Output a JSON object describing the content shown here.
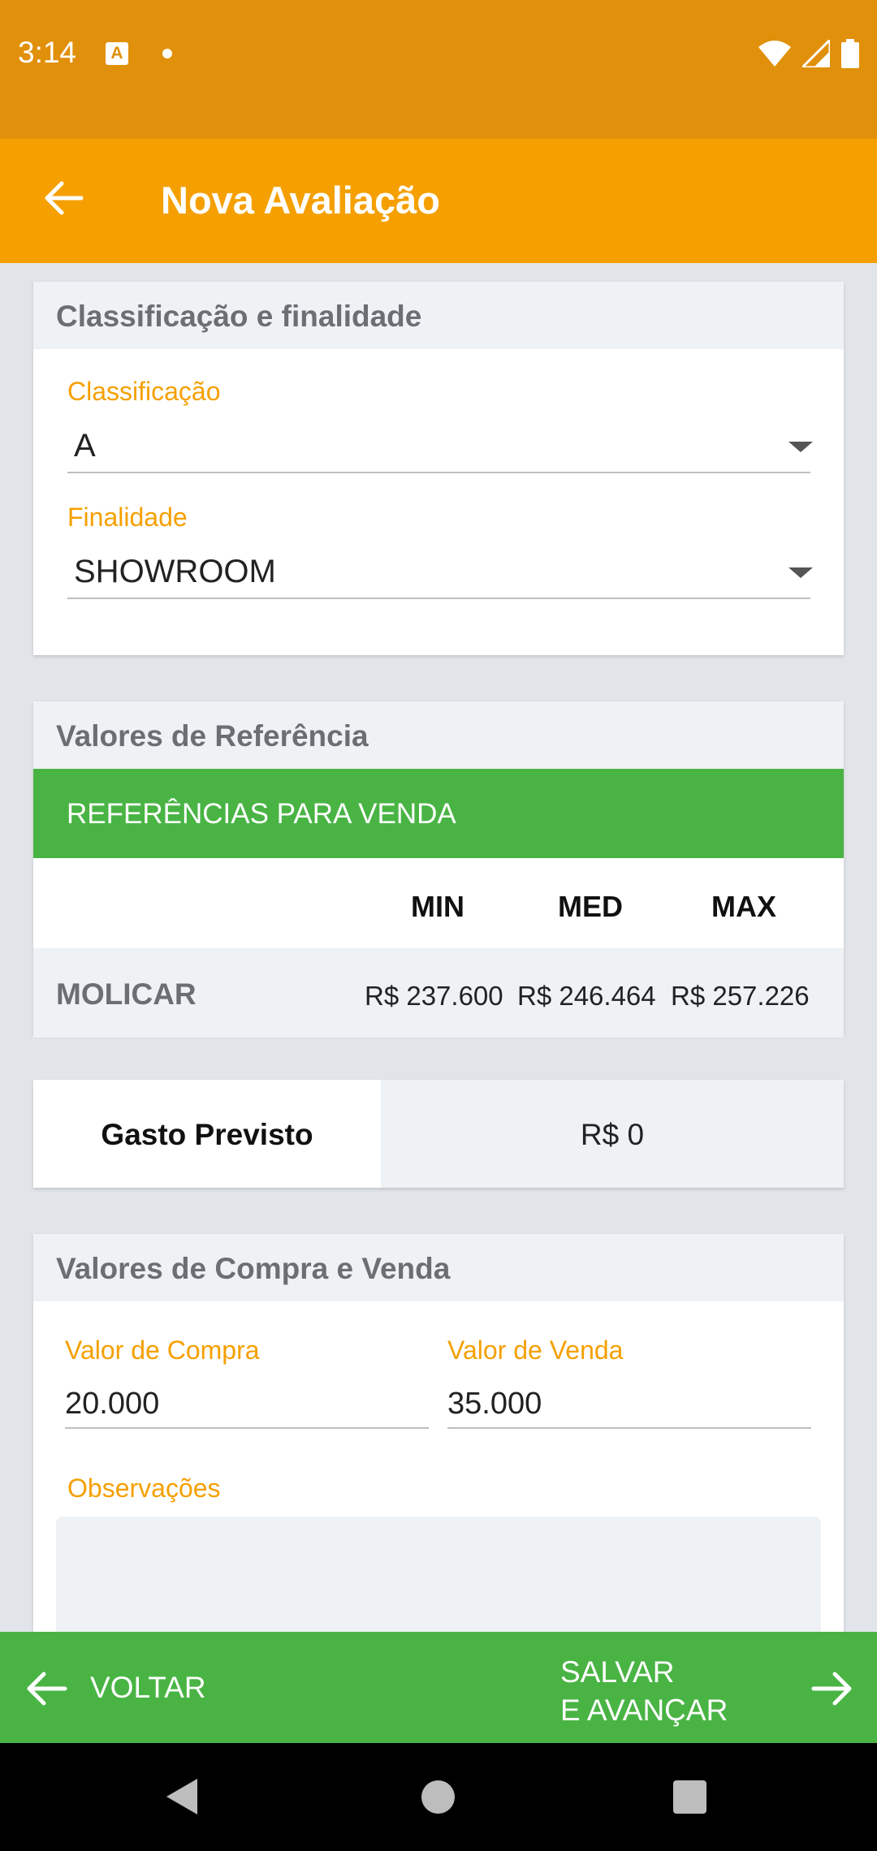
{
  "status_bar": {
    "time": "3:14",
    "notification_icon_letter": "A",
    "icons": [
      "wifi-icon",
      "signal-icon",
      "battery-icon"
    ]
  },
  "app_bar": {
    "title": "Nova Avaliação",
    "back_icon": "arrow-back-icon"
  },
  "classificacao_card": {
    "header": "Classificação e finalidade",
    "classificacao": {
      "label": "Classificação",
      "value": "A"
    },
    "finalidade": {
      "label": "Finalidade",
      "value": "SHOWROOM"
    }
  },
  "referencia_card": {
    "header": "Valores de Referência",
    "band_title": "REFERÊNCIAS PARA VENDA",
    "columns": [
      "MIN",
      "MED",
      "MAX"
    ],
    "rows": [
      {
        "name": "MOLICAR",
        "values": [
          "R$  237.600",
          "R$  246.464",
          "R$  257.226"
        ]
      }
    ]
  },
  "gasto_card": {
    "label": "Gasto Previsto",
    "value": "R$  0"
  },
  "compra_venda_card": {
    "header": "Valores de Compra e Venda",
    "compra": {
      "label": "Valor de Compra",
      "value": "20.000"
    },
    "venda": {
      "label": "Valor de Venda",
      "value": "35.000"
    },
    "observacoes": {
      "label": "Observações",
      "value": ""
    }
  },
  "bottom_bar": {
    "back_label": "VOLTAR",
    "next_label": "SALVAR\nE AVANÇAR"
  },
  "colors": {
    "status_bar": "#e0900a",
    "app_bar": "#f5a000",
    "accent_green": "#49b444",
    "label_orange": "#f5a000"
  }
}
